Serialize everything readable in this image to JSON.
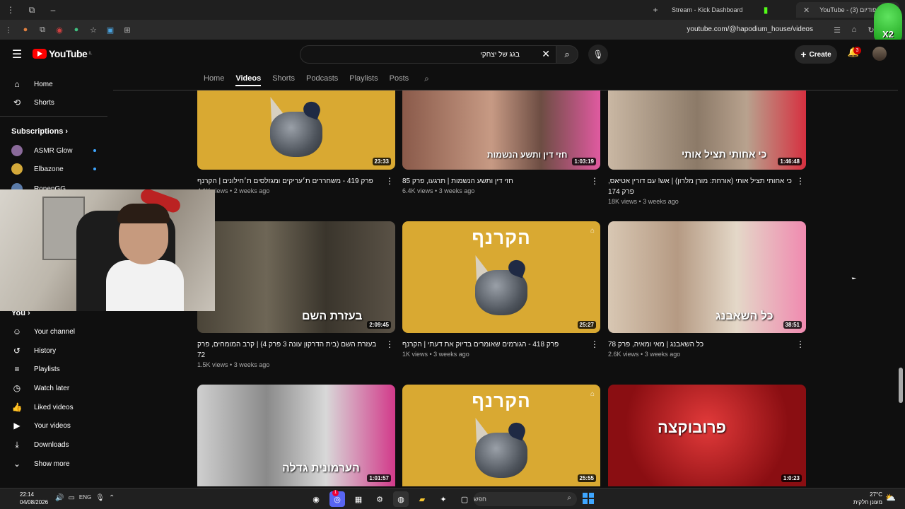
{
  "browser": {
    "tabs": [
      {
        "label": "Stream - Kick Dashboard"
      },
      {
        "label": "YouTube - בית הפודיום (3)"
      }
    ],
    "url": "youtube.com/@hapodium_house/videos"
  },
  "overlay": {
    "badge": "X2"
  },
  "header": {
    "logo_text": "YouTube",
    "logo_country": "IL",
    "search_value": "בגג של יצחקי",
    "create_label": "Create",
    "notifications_count": "3"
  },
  "channel_tabs": [
    "Home",
    "Videos",
    "Shorts",
    "Podcasts",
    "Playlists",
    "Posts"
  ],
  "sidebar": {
    "top": [
      {
        "label": "Home",
        "icon": "home-icon"
      },
      {
        "label": "Shorts",
        "icon": "shorts-icon"
      }
    ],
    "subscriptions_header": "Subscriptions",
    "subscriptions": [
      {
        "label": "ASMR Glow",
        "color": "#8a6a9a"
      },
      {
        "label": "Elbazone",
        "color": "#d4a93a"
      },
      {
        "label": "RonenGG",
        "color": "#5a7aa8"
      }
    ],
    "you_header": "You",
    "you_items": [
      {
        "label": "Your channel",
        "icon": "user-icon"
      },
      {
        "label": "History",
        "icon": "history-icon"
      },
      {
        "label": "Playlists",
        "icon": "playlist-icon"
      },
      {
        "label": "Watch later",
        "icon": "clock-icon"
      },
      {
        "label": "Liked videos",
        "icon": "like-icon"
      },
      {
        "label": "Your videos",
        "icon": "video-icon"
      },
      {
        "label": "Downloads",
        "icon": "download-icon"
      },
      {
        "label": "Show more",
        "icon": "chevron-down-icon"
      }
    ]
  },
  "videos": [
    {
      "title": "פרק 419 - משחררים ת׳עריקים ומגזלסים ת׳חילונים | הקרנף",
      "views": "4.1K views",
      "age": "2 weeks ago",
      "duration": "23:33",
      "caption": ""
    },
    {
      "title": "חזי דין ותשע הנשמות | תרגעו, פרק 85",
      "views": "6.4K views",
      "age": "3 weeks ago",
      "duration": "1:03:19",
      "caption": "חזי דין ותשע הנשמות"
    },
    {
      "title": "כי אחותי תציל אותי (אורחת: מורן מלרון) | אש! עם דורין אטיאס, פרק 174",
      "views": "18K views",
      "age": "3 weeks ago",
      "duration": "1:46:48",
      "caption": "כי אחותי תציל אותי"
    },
    {
      "title": "בעזרת השם (בית הדרקון עונה 3 פרק 4) | קרב המומחים, פרק 72",
      "views": "1.5K views",
      "age": "3 weeks ago",
      "duration": "2:09:45",
      "caption": "בעזרת השם"
    },
    {
      "title": "פרק 418 - הגורמים שאומרים בדיוק את דעתי | הקרנף",
      "views": "1K views",
      "age": "3 weeks ago",
      "duration": "25:27",
      "caption": "הקרנף"
    },
    {
      "title": "כל השאבנג | מאי ומאיה, פרק 78",
      "views": "2.6K views",
      "age": "3 weeks ago",
      "duration": "38:51",
      "caption": "כל השאבנג"
    },
    {
      "title": "",
      "views": "",
      "age": "",
      "duration": "1:01:57",
      "caption": "הערמונית גדלה"
    },
    {
      "title": "",
      "views": "",
      "age": "",
      "duration": "25:55",
      "caption": "הקרנף"
    },
    {
      "title": "",
      "views": "",
      "age": "",
      "duration": "1:0:23",
      "caption": "פרובוקצה"
    }
  ],
  "taskbar": {
    "time": "22:14",
    "date": "04/08/2026",
    "lang": "ENG",
    "search_placeholder": "חפש",
    "weather_temp": "27°C",
    "weather_desc": "מעונן חלקית",
    "notif": "1"
  }
}
